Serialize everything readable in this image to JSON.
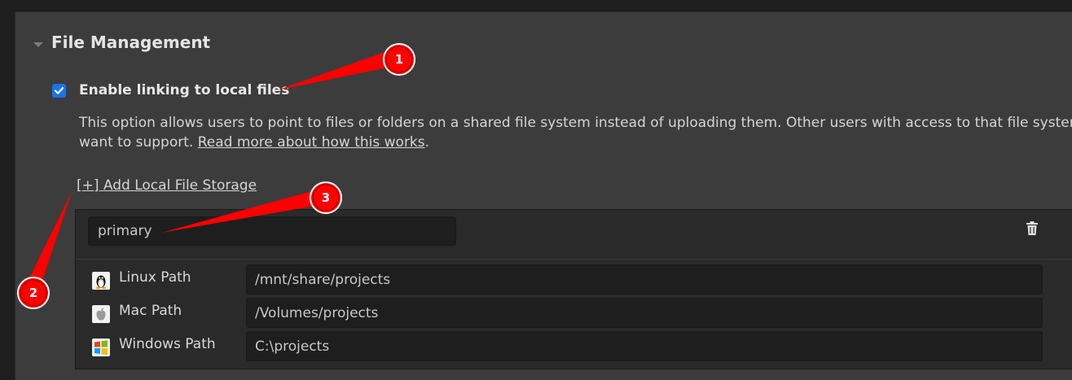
{
  "section": {
    "title": "File Management"
  },
  "linking": {
    "checked": true,
    "label": "Enable linking to local files",
    "description": "This option allows users to point to files or folders on a shared file system instead of uploading them. Other users with access to that file system",
    "description_line2": "want to support.",
    "read_more_link": "Read more about how this works",
    "period": "."
  },
  "add_storage": {
    "label": "[+] Add Local File Storage"
  },
  "storage": {
    "name_value": "primary",
    "paths": [
      {
        "label": "Linux Path",
        "value": "/mnt/share/projects",
        "icon": "linux-tux-icon"
      },
      {
        "label": "Mac Path",
        "value": "/Volumes/projects",
        "icon": "apple-icon"
      },
      {
        "label": "Windows Path",
        "value": "C:\\projects",
        "icon": "windows-icon"
      }
    ]
  },
  "annotations": {
    "badge_1": "1",
    "badge_2": "2",
    "badge_3": "3",
    "color": "#ff0000"
  }
}
